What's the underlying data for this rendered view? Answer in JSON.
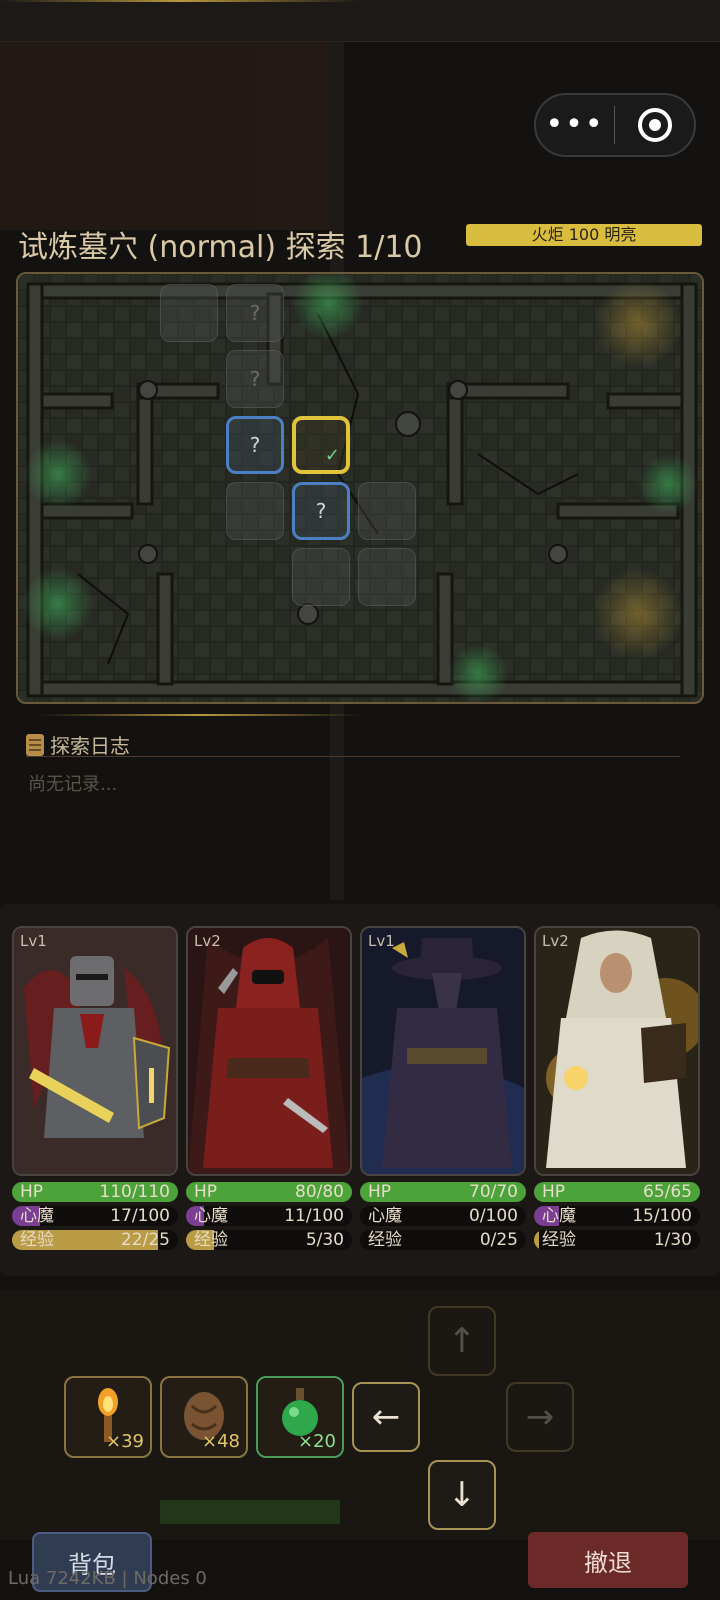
{
  "title": "试炼墓穴 (normal) 探索 1/10",
  "torch_label": "火炬 100 明亮",
  "map": {
    "tile_question_mark": "?",
    "current_tile_check": "✓"
  },
  "log": {
    "header": "探索日志",
    "empty_text": "尚无记录..."
  },
  "heroes": [
    {
      "level": "Lv1",
      "hp_label": "HP",
      "hp": "110/110",
      "hp_frac": 1.0,
      "mind_label": "心魔",
      "mind": "17/100",
      "mind_frac": 0.17,
      "exp_label": "经验",
      "exp": "22/25",
      "exp_frac": 0.88,
      "portrait": "knight-portrait"
    },
    {
      "level": "Lv2",
      "hp_label": "HP",
      "hp": "80/80",
      "hp_frac": 1.0,
      "mind_label": "心魔",
      "mind": "11/100",
      "mind_frac": 0.11,
      "exp_label": "经验",
      "exp": "5/30",
      "exp_frac": 0.17,
      "portrait": "rogue-portrait"
    },
    {
      "level": "Lv1",
      "hp_label": "HP",
      "hp": "70/70",
      "hp_frac": 1.0,
      "mind_label": "心魔",
      "mind": "0/100",
      "mind_frac": 0.0,
      "exp_label": "经验",
      "exp": "0/25",
      "exp_frac": 0.0,
      "portrait": "plague-doctor-portrait"
    },
    {
      "level": "Lv2",
      "hp_label": "HP",
      "hp": "65/65",
      "hp_frac": 1.0,
      "mind_label": "心魔",
      "mind": "15/100",
      "mind_frac": 0.15,
      "exp_label": "经验",
      "exp": "1/30",
      "exp_frac": 0.03,
      "portrait": "priestess-portrait"
    }
  ],
  "items": [
    {
      "icon": "torch-icon",
      "count": "×39"
    },
    {
      "icon": "food-sack-icon",
      "count": "×48"
    },
    {
      "icon": "green-potion-icon",
      "count": "×20"
    }
  ],
  "controls": {
    "left": "←",
    "down": "↓",
    "up": "↑",
    "right": "→"
  },
  "buttons": {
    "bag": "背包",
    "retreat": "撤退"
  },
  "debug_text": "Lua 7242KB | Nodes 0",
  "colors": {
    "hp": "#4ca33a",
    "mind": "#7a3f93",
    "exp": "#b99c45",
    "torch": "#d8bd3e",
    "gold_border": "#e2c43b",
    "blue_border": "#4c7fc4"
  }
}
